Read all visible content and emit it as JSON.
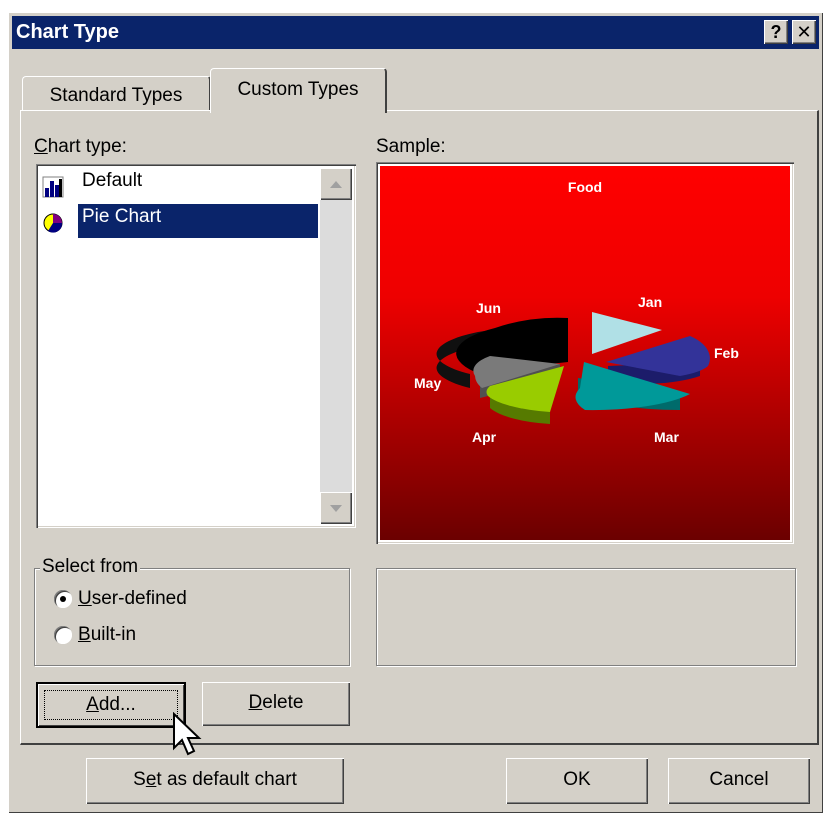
{
  "title": "Chart Type",
  "title_buttons": {
    "help": "?",
    "close": "✕"
  },
  "tabs": [
    {
      "label": "Standard Types",
      "selected": false
    },
    {
      "label": "Custom Types",
      "selected": true
    }
  ],
  "chart_type_label": {
    "pre": "",
    "u": "C",
    "post": "hart type:"
  },
  "list": {
    "items": [
      {
        "label": "Default",
        "icon": "bar-chart-icon",
        "selected": false
      },
      {
        "label": "Pie Chart",
        "icon": "pie-chart-icon",
        "selected": true
      }
    ]
  },
  "sample_label": "Sample:",
  "sample": {
    "title": "Food",
    "slice_labels": [
      "Jan",
      "Feb",
      "Mar",
      "Apr",
      "May",
      "Jun"
    ],
    "colors": {
      "bg_top": "#ff0000",
      "bg_bottom": "#6b0000"
    }
  },
  "select_from": {
    "legend": "Select from",
    "options": [
      {
        "pre": "",
        "u": "U",
        "post": "ser-defined",
        "checked": true
      },
      {
        "pre": "",
        "u": "B",
        "post": "uilt-in",
        "checked": false
      }
    ]
  },
  "buttons": {
    "add": {
      "pre": "",
      "u": "A",
      "post": "dd..."
    },
    "delete": {
      "pre": "",
      "u": "D",
      "post": "elete"
    },
    "set_default": {
      "pre": "S",
      "u": "e",
      "post": "t as default chart"
    },
    "ok": "OK",
    "cancel": "Cancel"
  }
}
